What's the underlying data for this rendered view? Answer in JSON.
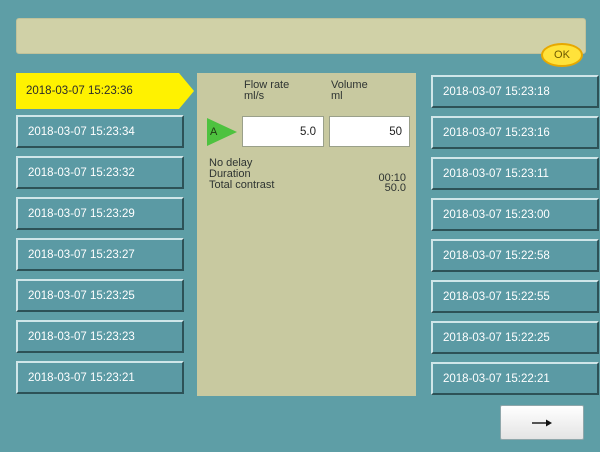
{
  "topbar": {
    "message": "",
    "ok_label": "OK"
  },
  "history": {
    "selected": "2018-03-07 15:23:36",
    "left": [
      "2018-03-07 15:23:34",
      "2018-03-07 15:23:32",
      "2018-03-07 15:23:29",
      "2018-03-07 15:23:27",
      "2018-03-07 15:23:25",
      "2018-03-07 15:23:23",
      "2018-03-07 15:23:21"
    ],
    "right": [
      "2018-03-07 15:23:18",
      "2018-03-07 15:23:16",
      "2018-03-07 15:23:11",
      "2018-03-07 15:23:00",
      "2018-03-07 15:22:58",
      "2018-03-07 15:22:55",
      "2018-03-07 15:22:25",
      "2018-03-07 15:22:21"
    ]
  },
  "details": {
    "flow_rate_label": "Flow rate",
    "flow_rate_unit": "ml/s",
    "volume_label": "Volume",
    "volume_unit": "ml",
    "phase_label": "A",
    "flow_rate_value": "5.0",
    "volume_value": "50",
    "delay_text": "No delay",
    "duration_label": "Duration",
    "duration_value": "00:10",
    "total_contrast_label": "Total contrast",
    "total_contrast_value": "50.0"
  },
  "footer": {
    "next_icon": "right-arrow-icon"
  },
  "colors": {
    "background": "#5e9ea6",
    "panel": "#c8c9a0",
    "selected": "#fff200",
    "ok_button": "#ffe23a",
    "phase_marker": "#4ec23f"
  }
}
